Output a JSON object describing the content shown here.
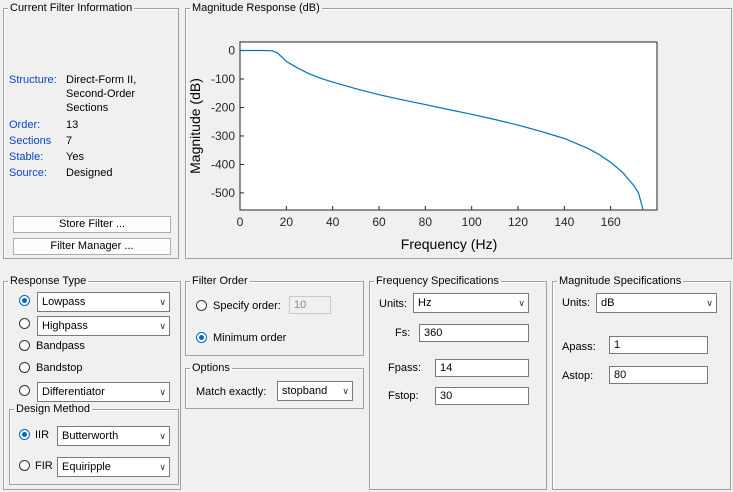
{
  "filter_info": {
    "legend": "Current Filter Information",
    "rows": [
      {
        "label": "Structure:",
        "value": "Direct-Form II, Second-Order Sections"
      },
      {
        "label": "Order:",
        "value": "13"
      },
      {
        "label": "Sections",
        "value": "7"
      },
      {
        "label": "Stable:",
        "value": "Yes"
      },
      {
        "label": "Source:",
        "value": "Designed"
      }
    ],
    "structure_lines": [
      "Direct-Form II,",
      "Second-Order",
      "Sections"
    ],
    "store_button": "Store Filter ...",
    "manager_button": "Filter Manager ..."
  },
  "magnitude_panel": {
    "legend": "Magnitude Response (dB)"
  },
  "chart_data": {
    "type": "line",
    "title": "",
    "xlabel": "Frequency (Hz)",
    "ylabel": "Magnitude (dB)",
    "xlim": [
      0,
      180
    ],
    "ylim": [
      -560,
      30
    ],
    "xticks": [
      0,
      20,
      40,
      60,
      80,
      100,
      120,
      140,
      160
    ],
    "yticks": [
      0,
      -100,
      -200,
      -300,
      -400,
      -500
    ],
    "grid": false,
    "line_color": "#0072bd",
    "series": [
      {
        "x": [
          0,
          10,
          14,
          16,
          18,
          20,
          25,
          30,
          35,
          40,
          50,
          60,
          70,
          80,
          90,
          100,
          110,
          120,
          130,
          140,
          150,
          155,
          160,
          165,
          170,
          172,
          174
        ],
        "y": [
          0,
          0,
          -1,
          -8,
          -22,
          -38,
          -62,
          -82,
          -98,
          -111,
          -134,
          -155,
          -173,
          -190,
          -207,
          -224,
          -242,
          -262,
          -284,
          -309,
          -343,
          -365,
          -393,
          -427,
          -474,
          -500,
          -560
        ]
      }
    ]
  },
  "response_type": {
    "legend": "Response Type",
    "options": [
      {
        "label": "Lowpass",
        "checked": true,
        "dropdown": "Lowpass"
      },
      {
        "label": "Highpass",
        "checked": false,
        "dropdown": "Highpass"
      },
      {
        "label": "Bandpass",
        "checked": false
      },
      {
        "label": "Bandstop",
        "checked": false
      },
      {
        "label": "Differentiator",
        "checked": false,
        "dropdown": "Differentiator"
      }
    ]
  },
  "design_method": {
    "legend": "Design Method",
    "iir": {
      "label": "IIR",
      "value": "Butterworth",
      "checked": true
    },
    "fir": {
      "label": "FIR",
      "value": "Equiripple",
      "checked": false
    }
  },
  "filter_order": {
    "legend": "Filter Order",
    "specify_label": "Specify order:",
    "specify_value": "10",
    "minimum_label": "Minimum order"
  },
  "options": {
    "legend": "Options",
    "match_label": "Match exactly:",
    "match_value": "stopband"
  },
  "freq_specs": {
    "legend": "Frequency Specifications",
    "units_label": "Units:",
    "units_value": "Hz",
    "fs_label": "Fs:",
    "fs_value": "360",
    "fpass_label": "Fpass:",
    "fpass_value": "14",
    "fstop_label": "Fstop:",
    "fstop_value": "30"
  },
  "mag_specs": {
    "legend": "Magnitude Specifications",
    "units_label": "Units:",
    "units_value": "dB",
    "apass_label": "Apass:",
    "apass_value": "1",
    "astop_label": "Astop:",
    "astop_value": "80"
  },
  "icons": {
    "dropdown": "chevron-down-icon",
    "radio": "radio-button"
  }
}
